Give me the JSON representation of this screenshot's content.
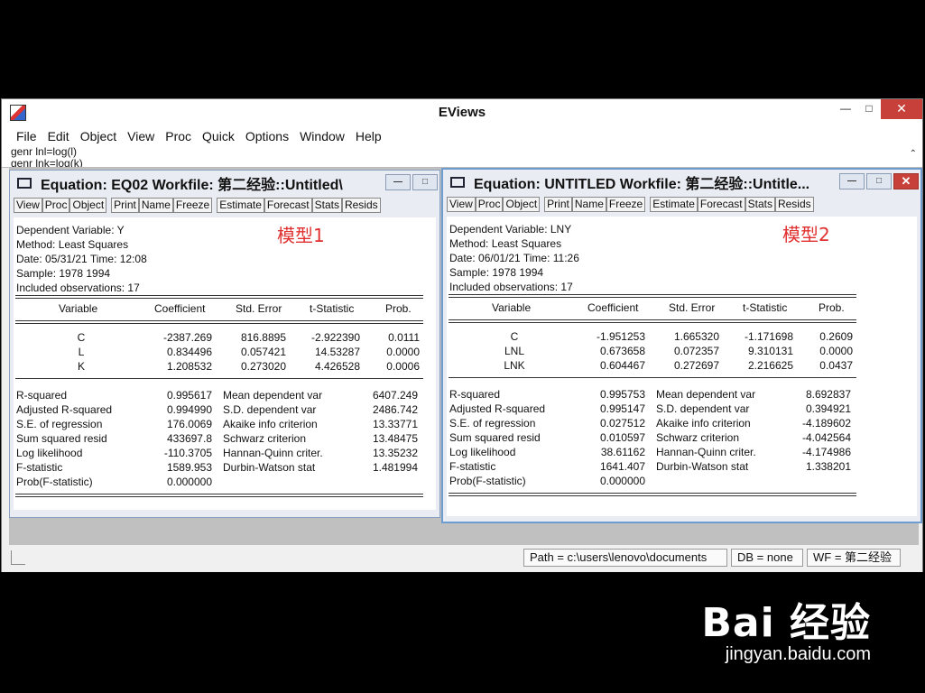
{
  "app": {
    "title": "EViews"
  },
  "window_buttons": {
    "minimize": "—",
    "maximize": "□",
    "close": "✕"
  },
  "menu": [
    "File",
    "Edit",
    "Object",
    "View",
    "Proc",
    "Quick",
    "Options",
    "Window",
    "Help"
  ],
  "command": {
    "line1": "genr lnl=log(l)",
    "line2": "genr lnk=log(k)"
  },
  "toolbar_buttons": [
    "View",
    "Proc",
    "Object",
    "Print",
    "Name",
    "Freeze",
    "Estimate",
    "Forecast",
    "Stats",
    "Resids"
  ],
  "col_headers": {
    "variable": "Variable",
    "coef": "Coefficient",
    "stderr": "Std. Error",
    "tstat": "t-Statistic",
    "prob": "Prob."
  },
  "eq1": {
    "title": "Equation: EQ02   Workfile: 第二经验::Untitled\\",
    "label": "模型1",
    "header": [
      "Dependent Variable: Y",
      "Method: Least Squares",
      "Date: 05/31/21   Time: 12:08",
      "Sample: 1978 1994",
      "Included observations: 17"
    ],
    "rows": [
      {
        "var": "C",
        "coef": "-2387.269",
        "se": "816.8895",
        "t": "-2.922390",
        "p": "0.0111"
      },
      {
        "var": "L",
        "coef": "0.834496",
        "se": "0.057421",
        "t": "14.53287",
        "p": "0.0000"
      },
      {
        "var": "K",
        "coef": "1.208532",
        "se": "0.273020",
        "t": "4.426528",
        "p": "0.0006"
      }
    ],
    "stats_left": [
      {
        "label": "R-squared",
        "value": "0.995617"
      },
      {
        "label": "Adjusted R-squared",
        "value": "0.994990"
      },
      {
        "label": "S.E. of regression",
        "value": "176.0069"
      },
      {
        "label": "Sum squared resid",
        "value": "433697.8"
      },
      {
        "label": "Log likelihood",
        "value": "-110.3705"
      },
      {
        "label": "F-statistic",
        "value": "1589.953"
      },
      {
        "label": "Prob(F-statistic)",
        "value": "0.000000"
      }
    ],
    "stats_right": [
      {
        "label": "Mean dependent var",
        "value": "6407.249"
      },
      {
        "label": "S.D. dependent var",
        "value": "2486.742"
      },
      {
        "label": "Akaike info criterion",
        "value": "13.33771"
      },
      {
        "label": "Schwarz criterion",
        "value": "13.48475"
      },
      {
        "label": "Hannan-Quinn criter.",
        "value": "13.35232"
      },
      {
        "label": "Durbin-Watson stat",
        "value": "1.481994"
      }
    ]
  },
  "eq2": {
    "title": "Equation: UNTITLED   Workfile: 第二经验::Untitle...",
    "label": "模型2",
    "header": [
      "Dependent Variable: LNY",
      "Method: Least Squares",
      "Date: 06/01/21   Time: 11:26",
      "Sample: 1978 1994",
      "Included observations: 17"
    ],
    "rows": [
      {
        "var": "C",
        "coef": "-1.951253",
        "se": "1.665320",
        "t": "-1.171698",
        "p": "0.2609"
      },
      {
        "var": "LNL",
        "coef": "0.673658",
        "se": "0.072357",
        "t": "9.310131",
        "p": "0.0000"
      },
      {
        "var": "LNK",
        "coef": "0.604467",
        "se": "0.272697",
        "t": "2.216625",
        "p": "0.0437"
      }
    ],
    "stats_left": [
      {
        "label": "R-squared",
        "value": "0.995753"
      },
      {
        "label": "Adjusted R-squared",
        "value": "0.995147"
      },
      {
        "label": "S.E. of regression",
        "value": "0.027512"
      },
      {
        "label": "Sum squared resid",
        "value": "0.010597"
      },
      {
        "label": "Log likelihood",
        "value": "38.61162"
      },
      {
        "label": "F-statistic",
        "value": "1641.407"
      },
      {
        "label": "Prob(F-statistic)",
        "value": "0.000000"
      }
    ],
    "stats_right": [
      {
        "label": "Mean dependent var",
        "value": "8.692837"
      },
      {
        "label": "S.D. dependent var",
        "value": "0.394921"
      },
      {
        "label": "Akaike info criterion",
        "value": "-4.189602"
      },
      {
        "label": "Schwarz criterion",
        "value": "-4.042564"
      },
      {
        "label": "Hannan-Quinn criter.",
        "value": "-4.174986"
      },
      {
        "label": "Durbin-Watson stat",
        "value": "1.338201"
      }
    ]
  },
  "status": {
    "path": "Path = c:\\users\\lenovo\\documents",
    "db": "DB = none",
    "wf": "WF = 第二经验"
  },
  "watermark": {
    "logo": "Bai  经验",
    "site": "jingyan.baidu.com"
  }
}
